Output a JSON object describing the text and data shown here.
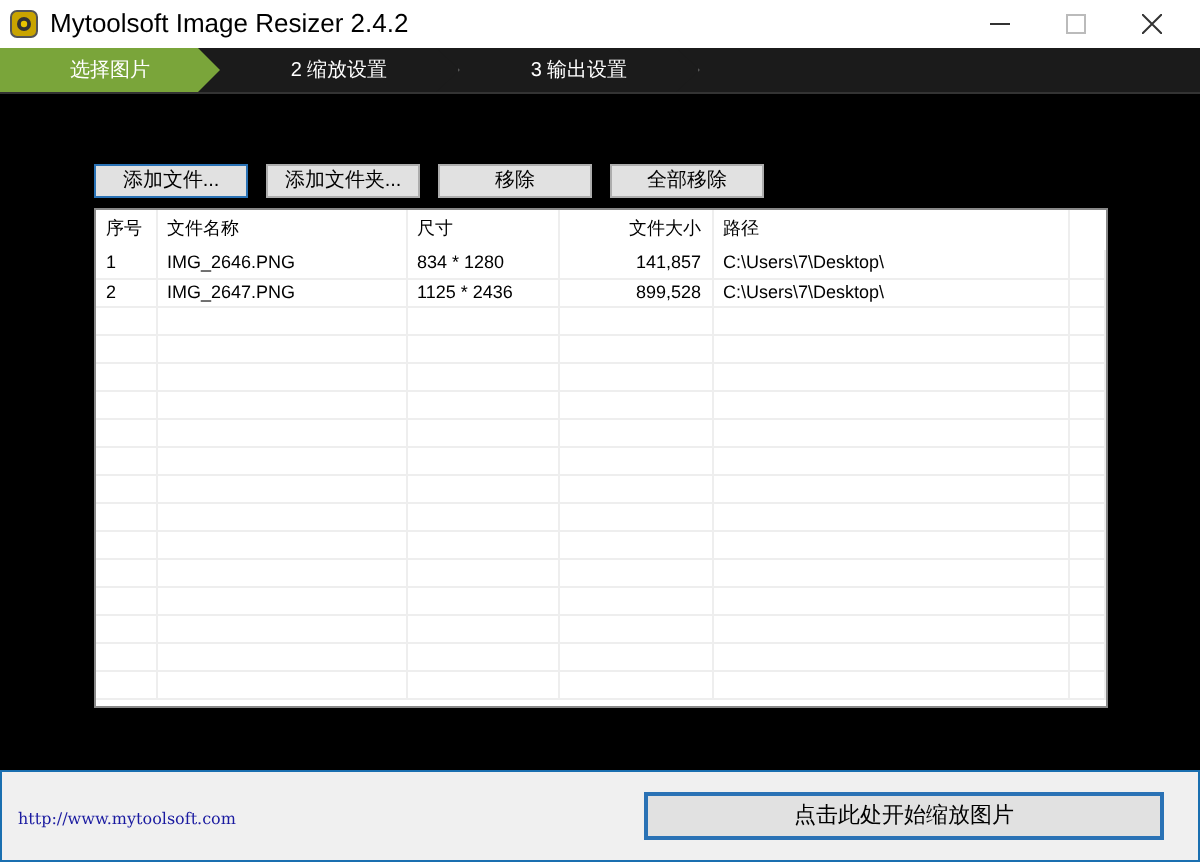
{
  "window": {
    "title": "Mytoolsoft Image Resizer 2.4.2"
  },
  "steps": [
    {
      "label": "选择图片",
      "selected": true
    },
    {
      "label": "2  缩放设置",
      "selected": false
    },
    {
      "label": "3  输出设置",
      "selected": false
    }
  ],
  "buttons": [
    {
      "label": "添加文件...",
      "focused": true
    },
    {
      "label": "添加文件夹...",
      "focused": false
    },
    {
      "label": "移除",
      "focused": false
    },
    {
      "label": "全部移除",
      "focused": false
    }
  ],
  "table": {
    "columns": [
      "序号",
      "文件名称",
      "尺寸",
      "文件大小",
      "路径"
    ],
    "rows": [
      [
        "1",
        "IMG_2646.PNG",
        "834 * 1280",
        "141,857",
        "C:\\Users\\7\\Desktop\\"
      ],
      [
        "2",
        "IMG_2647.PNG",
        "1125 * 2436",
        "899,528",
        "C:\\Users\\7\\Desktop\\"
      ]
    ]
  },
  "footer": {
    "link": "http://www.mytoolsoft.com",
    "start_button": "点击此处开始缩放图片"
  }
}
